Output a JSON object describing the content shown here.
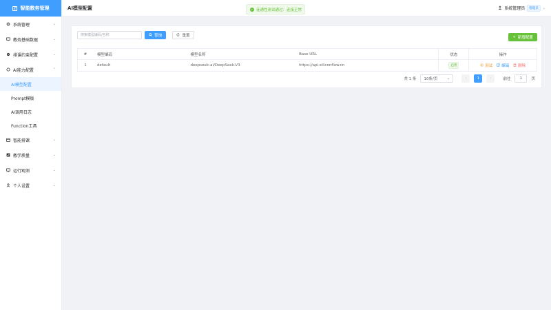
{
  "app": {
    "name": "智能教务管理"
  },
  "sidebar": {
    "items": [
      {
        "label": "系统管理",
        "icon": "gear-icon",
        "expanded": false
      },
      {
        "label": "教务基础数据",
        "icon": "monitor-icon",
        "expanded": false
      },
      {
        "label": "排课约束配置",
        "icon": "cog-icon",
        "expanded": false
      },
      {
        "label": "AI能力配置",
        "icon": "ring-icon",
        "expanded": true,
        "children": [
          {
            "label": "AI模型配置",
            "active": true
          },
          {
            "label": "Prompt模板",
            "active": false
          },
          {
            "label": "AI调用日志",
            "active": false
          },
          {
            "label": "Function工具",
            "active": false
          }
        ]
      },
      {
        "label": "智能排课",
        "icon": "calendar-icon",
        "expanded": false
      },
      {
        "label": "教学质量",
        "icon": "checkbox-icon",
        "expanded": false
      },
      {
        "label": "运行观测",
        "icon": "screen-icon",
        "expanded": false
      },
      {
        "label": "个人设置",
        "icon": "user-icon",
        "expanded": false
      }
    ]
  },
  "header": {
    "title": "AI模型配置",
    "user": {
      "name": "系统管理员",
      "role": "管理员"
    }
  },
  "toast": {
    "message": "连通性测试通过：连接正常"
  },
  "toolbar": {
    "search_placeholder": "搜索模型编码/名称",
    "query_label": "查询",
    "reset_label": "重置",
    "new_label": "新增配置"
  },
  "table": {
    "headers": {
      "idx": "#",
      "code": "模型编码",
      "name": "模型名称",
      "url": "Base URL",
      "status": "状态",
      "ops": "操作"
    },
    "rows": [
      {
        "idx": "1",
        "code": "default",
        "name": "deepseek-ai/DeepSeek-V3",
        "url": "https://api.siliconflow.cn",
        "status": "启用"
      }
    ],
    "ops": {
      "test": "测试",
      "edit": "编辑",
      "delete": "删除"
    }
  },
  "pagination": {
    "total": "共 1 条",
    "page_size": "10条/页",
    "current_page": "1",
    "jump_prefix": "前往",
    "jump_value": "1",
    "jump_suffix": "页"
  },
  "colors": {
    "primary": "#409eff",
    "success": "#67c23a",
    "warning": "#e6a23c",
    "danger": "#f56c6c"
  }
}
